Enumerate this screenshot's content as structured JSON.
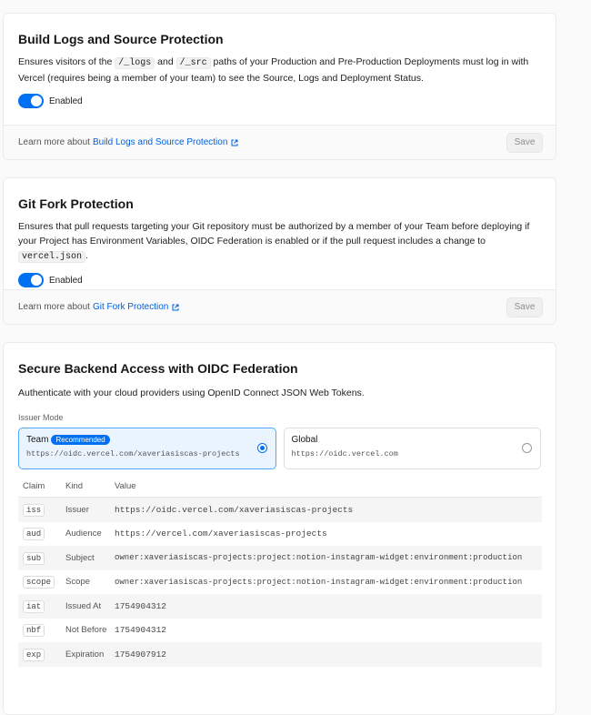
{
  "build_logs": {
    "title": "Build Logs and Source Protection",
    "desc_1": "Ensures visitors of the",
    "code_1": "/_logs",
    "desc_2": "and",
    "code_2": "/_src",
    "desc_3": "paths of your Production and Pre-Production Deployments must log in with Vercel (requires being a member of your team) to see the Source, Logs and Deployment Status.",
    "toggle_label": "Enabled",
    "footer_text": "Learn more about",
    "footer_link": "Build Logs and Source Protection",
    "save_label": "Save"
  },
  "git_fork": {
    "title": "Git Fork Protection",
    "desc_1": "Ensures that pull requests targeting your Git repository must be authorized by a member of your Team before deploying if your Project has Environment Variables, OIDC Federation is enabled or if the pull request includes a change to",
    "code_1": "vercel.json",
    "desc_2": ".",
    "toggle_label": "Enabled",
    "footer_text": "Learn more about",
    "footer_link": "Git Fork Protection",
    "save_label": "Save"
  },
  "oidc": {
    "title": "Secure Backend Access with OIDC Federation",
    "desc": "Authenticate with your cloud providers using OpenID Connect JSON Web Tokens.",
    "issuer_mode_label": "Issuer Mode",
    "options": [
      {
        "name": "Team",
        "badge": "Recommended",
        "url": "https://oidc.vercel.com/xaveriasiscas-projects",
        "selected": true
      },
      {
        "name": "Global",
        "badge": "",
        "url": "https://oidc.vercel.com",
        "selected": false
      }
    ],
    "table_headers": [
      "Claim",
      "Kind",
      "Value"
    ],
    "rows": [
      {
        "claim": "iss",
        "kind": "Issuer",
        "value": "https://oidc.vercel.com/xaveriasiscas-projects"
      },
      {
        "claim": "aud",
        "kind": "Audience",
        "value": "https://vercel.com/xaveriasiscas-projects"
      },
      {
        "claim": "sub",
        "kind": "Subject",
        "value": "owner:xaveriasiscas-projects:project:notion-instagram-widget:environment:production"
      },
      {
        "claim": "scope",
        "kind": "Scope",
        "value": "owner:xaveriasiscas-projects:project:notion-instagram-widget:environment:production"
      },
      {
        "claim": "iat",
        "kind": "Issued At",
        "value": "1754904312"
      },
      {
        "claim": "nbf",
        "kind": "Not Before",
        "value": "1754904312"
      },
      {
        "claim": "exp",
        "kind": "Expiration",
        "value": "1754907912"
      }
    ]
  },
  "colors": {
    "accent": "#0070f3",
    "link": "#0060df"
  }
}
